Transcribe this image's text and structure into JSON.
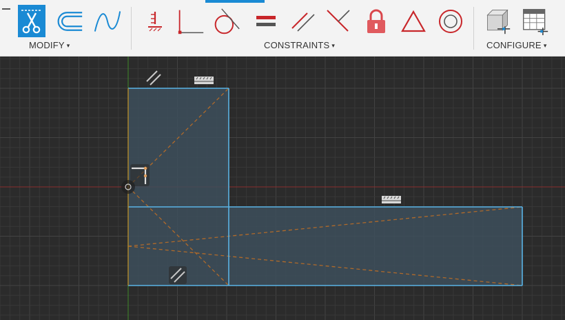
{
  "toolbar": {
    "groups": {
      "modify": {
        "label": "MODIFY"
      },
      "constraints": {
        "label": "CONSTRAINTS"
      },
      "configure": {
        "label": "CONFIGURE"
      }
    },
    "caret": "▾",
    "tools": {
      "modify": [
        "trim-icon",
        "offset-icon",
        "spline-icon"
      ],
      "constraints": [
        "horizontal-vertical-icon",
        "coincident-icon",
        "tangent-icon",
        "equal-icon",
        "parallel-icon",
        "perpendicular-icon",
        "fix-icon",
        "midpoint-icon",
        "concentric-icon"
      ],
      "configure": [
        "parameters-icon",
        "configure-table-icon"
      ]
    },
    "colors": {
      "accent": "#1a8ad4",
      "constraint_red": "#c8262a"
    }
  },
  "sketch": {
    "colors": {
      "background": "#2b2b2b",
      "grid_minor": "#383838",
      "grid_major": "#434343",
      "x_axis": "#8a2d2d",
      "y_axis": "#3f8a2a",
      "profile_line": "#5ab4e6",
      "profile_fill": "#3d4f5c",
      "construction_line": "#b06a2a"
    },
    "constraint_glyphs": [
      "parallel-constraint-glyph",
      "horizontal-dimension-glyph",
      "perpendicular-constraint-glyph",
      "origin-point"
    ]
  }
}
